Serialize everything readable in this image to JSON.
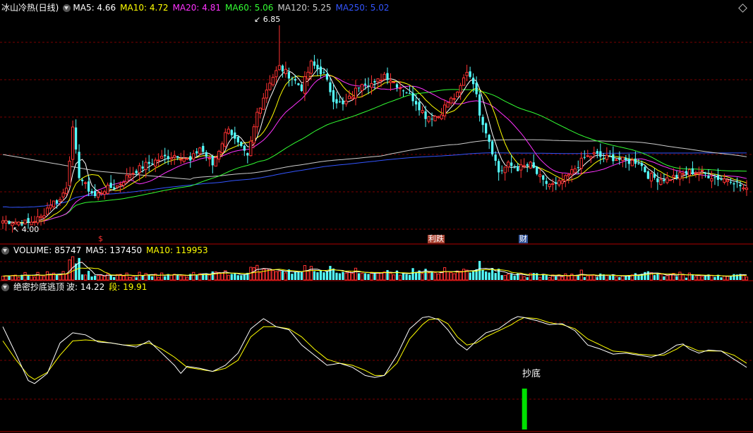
{
  "price_panel": {
    "title": "冰山冷热(日线)",
    "ma": [
      {
        "label": "MA5: 4.66",
        "color": "#ffffff"
      },
      {
        "label": "MA10: 4.72",
        "color": "#ffff00"
      },
      {
        "label": "MA20: 4.81",
        "color": "#ff33ff"
      },
      {
        "label": "MA60: 5.06",
        "color": "#33ff33"
      },
      {
        "label": "MA120: 5.25",
        "color": "#cccccc"
      },
      {
        "label": "MA250: 5.02",
        "color": "#3355ff"
      }
    ],
    "high_label": "6.85",
    "low_label": "4.00",
    "events": [
      {
        "label": "$",
        "color": "#ff3333",
        "bg": "transparent"
      },
      {
        "label": "利跌",
        "color": "#ffffff",
        "bg": "#aa4433"
      },
      {
        "label": "财",
        "color": "#ffffff",
        "bg": "#335599"
      }
    ]
  },
  "volume_panel": {
    "title": "VOLUME: 85747",
    "ma5": "MA5: 137450",
    "ma10": "MA10: 119953"
  },
  "indicator_panel": {
    "title": "绝密抄底逃顶",
    "wave": "波: 14.22",
    "segment": "段: 19.91",
    "signal_label": "抄底"
  },
  "colors": {
    "up": "#ff3232",
    "down": "#54ffff",
    "grid": "#7a0000",
    "white": "#ffffff",
    "yellow": "#ffff00",
    "signal": "#00e000"
  },
  "chart_data": {
    "type": "candlestick",
    "price_high": 6.85,
    "price_low": 4.0,
    "keypoints": [
      [
        0,
        4.05
      ],
      [
        8,
        4.02
      ],
      [
        12,
        4.1
      ],
      [
        15,
        4.3
      ],
      [
        18,
        4.35
      ],
      [
        20,
        4.55
      ],
      [
        22,
        5.35
      ],
      [
        24,
        4.7
      ],
      [
        26,
        4.55
      ],
      [
        29,
        4.4
      ],
      [
        32,
        4.5
      ],
      [
        36,
        4.55
      ],
      [
        40,
        4.72
      ],
      [
        45,
        4.85
      ],
      [
        50,
        4.95
      ],
      [
        55,
        5.0
      ],
      [
        59,
        4.9
      ],
      [
        62,
        5.1
      ],
      [
        66,
        4.85
      ],
      [
        71,
        5.4
      ],
      [
        73,
        5.2
      ],
      [
        77,
        4.95
      ],
      [
        80,
        5.6
      ],
      [
        84,
        6.05
      ],
      [
        87,
        6.25
      ],
      [
        91,
        6.1
      ],
      [
        94,
        5.95
      ],
      [
        97,
        6.3
      ],
      [
        101,
        6.15
      ],
      [
        104,
        5.8
      ],
      [
        107,
        5.7
      ],
      [
        110,
        5.85
      ],
      [
        113,
        6.05
      ],
      [
        117,
        6.0
      ],
      [
        120,
        6.15
      ],
      [
        124,
        6.0
      ],
      [
        127,
        5.9
      ],
      [
        130,
        5.75
      ],
      [
        133,
        5.55
      ],
      [
        137,
        5.55
      ],
      [
        140,
        5.75
      ],
      [
        143,
        5.85
      ],
      [
        146,
        6.2
      ],
      [
        148,
        6.05
      ],
      [
        150,
        5.6
      ],
      [
        153,
        5.2
      ],
      [
        156,
        4.75
      ],
      [
        159,
        4.85
      ],
      [
        162,
        4.8
      ],
      [
        166,
        4.85
      ],
      [
        170,
        4.6
      ],
      [
        174,
        4.55
      ],
      [
        177,
        4.65
      ],
      [
        180,
        4.8
      ],
      [
        183,
        4.95
      ],
      [
        186,
        5.0
      ],
      [
        189,
        4.95
      ],
      [
        192,
        4.95
      ],
      [
        196,
        4.9
      ],
      [
        200,
        4.9
      ],
      [
        203,
        4.7
      ],
      [
        206,
        4.65
      ],
      [
        209,
        4.65
      ],
      [
        213,
        4.7
      ],
      [
        216,
        4.75
      ],
      [
        219,
        4.75
      ],
      [
        222,
        4.7
      ],
      [
        226,
        4.65
      ],
      [
        229,
        4.65
      ],
      [
        232,
        4.55
      ],
      [
        234,
        4.48
      ]
    ],
    "indicator_white": [
      [
        0,
        0.88
      ],
      [
        4,
        0.62
      ],
      [
        8,
        0.35
      ],
      [
        10,
        0.32
      ],
      [
        14,
        0.42
      ],
      [
        18,
        0.72
      ],
      [
        22,
        0.82
      ],
      [
        26,
        0.8
      ],
      [
        30,
        0.73
      ],
      [
        34,
        0.72
      ],
      [
        38,
        0.7
      ],
      [
        42,
        0.68
      ],
      [
        46,
        0.74
      ],
      [
        50,
        0.62
      ],
      [
        54,
        0.5
      ],
      [
        56,
        0.42
      ],
      [
        58,
        0.49
      ],
      [
        62,
        0.47
      ],
      [
        66,
        0.44
      ],
      [
        70,
        0.5
      ],
      [
        74,
        0.62
      ],
      [
        78,
        0.86
      ],
      [
        82,
        0.96
      ],
      [
        86,
        0.88
      ],
      [
        90,
        0.85
      ],
      [
        94,
        0.7
      ],
      [
        98,
        0.6
      ],
      [
        102,
        0.5
      ],
      [
        106,
        0.52
      ],
      [
        110,
        0.48
      ],
      [
        114,
        0.4
      ],
      [
        117,
        0.38
      ],
      [
        120,
        0.4
      ],
      [
        124,
        0.6
      ],
      [
        128,
        0.86
      ],
      [
        132,
        0.97
      ],
      [
        134,
        0.98
      ],
      [
        137,
        0.95
      ],
      [
        140,
        0.85
      ],
      [
        143,
        0.72
      ],
      [
        146,
        0.65
      ],
      [
        149,
        0.74
      ],
      [
        152,
        0.82
      ],
      [
        156,
        0.86
      ],
      [
        160,
        0.95
      ],
      [
        162,
        0.98
      ],
      [
        164,
        0.97
      ],
      [
        168,
        0.94
      ],
      [
        172,
        0.9
      ],
      [
        176,
        0.91
      ],
      [
        180,
        0.84
      ],
      [
        184,
        0.7
      ],
      [
        188,
        0.66
      ],
      [
        192,
        0.61
      ],
      [
        196,
        0.62
      ],
      [
        200,
        0.6
      ],
      [
        204,
        0.58
      ],
      [
        208,
        0.62
      ],
      [
        212,
        0.7
      ],
      [
        214,
        0.71
      ],
      [
        216,
        0.66
      ],
      [
        219,
        0.62
      ],
      [
        222,
        0.65
      ],
      [
        226,
        0.64
      ],
      [
        230,
        0.56
      ],
      [
        234,
        0.48
      ]
    ],
    "indicator_yellow": [
      [
        0,
        0.74
      ],
      [
        4,
        0.56
      ],
      [
        8,
        0.4
      ],
      [
        10,
        0.36
      ],
      [
        14,
        0.43
      ],
      [
        18,
        0.6
      ],
      [
        22,
        0.74
      ],
      [
        26,
        0.75
      ],
      [
        30,
        0.74
      ],
      [
        34,
        0.72
      ],
      [
        38,
        0.7
      ],
      [
        42,
        0.7
      ],
      [
        46,
        0.72
      ],
      [
        50,
        0.66
      ],
      [
        54,
        0.58
      ],
      [
        58,
        0.48
      ],
      [
        62,
        0.46
      ],
      [
        66,
        0.44
      ],
      [
        70,
        0.47
      ],
      [
        74,
        0.55
      ],
      [
        78,
        0.78
      ],
      [
        82,
        0.88
      ],
      [
        86,
        0.88
      ],
      [
        90,
        0.86
      ],
      [
        94,
        0.78
      ],
      [
        98,
        0.66
      ],
      [
        102,
        0.56
      ],
      [
        106,
        0.52
      ],
      [
        110,
        0.5
      ],
      [
        114,
        0.45
      ],
      [
        117,
        0.4
      ],
      [
        120,
        0.4
      ],
      [
        124,
        0.52
      ],
      [
        128,
        0.76
      ],
      [
        132,
        0.9
      ],
      [
        134,
        0.95
      ],
      [
        137,
        0.96
      ],
      [
        140,
        0.91
      ],
      [
        143,
        0.78
      ],
      [
        146,
        0.7
      ],
      [
        149,
        0.72
      ],
      [
        152,
        0.78
      ],
      [
        156,
        0.84
      ],
      [
        160,
        0.9
      ],
      [
        162,
        0.94
      ],
      [
        164,
        0.97
      ],
      [
        168,
        0.96
      ],
      [
        172,
        0.92
      ],
      [
        176,
        0.9
      ],
      [
        180,
        0.86
      ],
      [
        184,
        0.76
      ],
      [
        188,
        0.7
      ],
      [
        192,
        0.64
      ],
      [
        196,
        0.63
      ],
      [
        200,
        0.61
      ],
      [
        204,
        0.6
      ],
      [
        208,
        0.6
      ],
      [
        212,
        0.66
      ],
      [
        214,
        0.7
      ],
      [
        216,
        0.68
      ],
      [
        219,
        0.64
      ],
      [
        222,
        0.64
      ],
      [
        226,
        0.64
      ],
      [
        230,
        0.6
      ],
      [
        234,
        0.52
      ]
    ]
  }
}
